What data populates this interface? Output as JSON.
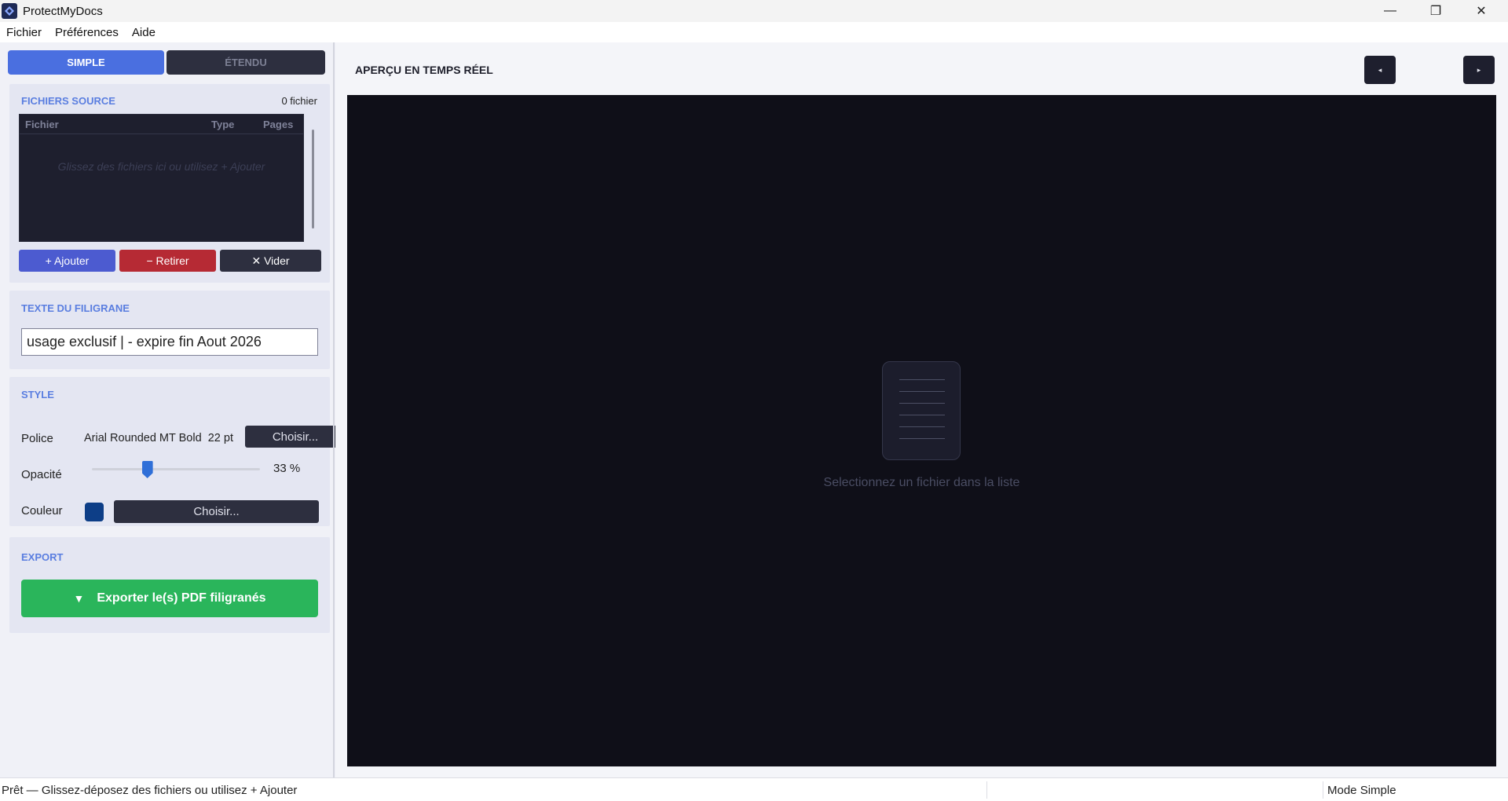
{
  "window": {
    "title": "ProtectMyDocs",
    "minimize": "—",
    "restore": "❐",
    "close": "✕"
  },
  "menu": {
    "items": [
      "Fichier",
      "Préférences",
      "Aide"
    ]
  },
  "mode": {
    "simple": "SIMPLE",
    "etendu": "ÉTENDU"
  },
  "sources": {
    "title": "FICHIERS SOURCE",
    "count": "0 fichier",
    "columns": [
      "Fichier",
      "Type",
      "Pages"
    ],
    "empty_hint": "Glissez des fichiers ici ou utilisez + Ajouter",
    "add_label": "+ Ajouter",
    "remove_label": "− Retirer",
    "clear_label": "✕ Vider"
  },
  "watermark": {
    "title": "TEXTE DU FILIGRANE",
    "value": "usage exclusif | - expire fin Aout 2026"
  },
  "style": {
    "title": "STYLE",
    "police_label": "Police",
    "font_name": "Arial Rounded MT Bold",
    "font_size": "22 pt",
    "choose_font_label": "Choisir...",
    "opacity_label": "Opacité",
    "opacity_value": "33 %",
    "opacity_fraction": 0.33,
    "color_label": "Couleur",
    "color_value": "#0d3e87",
    "choose_color_label": "Choisir..."
  },
  "export": {
    "title": "EXPORT",
    "button_label": "Exporter le(s) PDF filigranés",
    "icon": "▼"
  },
  "preview": {
    "title": "APERÇU EN TEMPS RÉEL",
    "prev": "◂",
    "next": "▸",
    "hint": "Selectionnez un fichier dans la liste"
  },
  "status": {
    "text": "Prêt  —  Glissez-déposez des fichiers ou utilisez + Ajouter",
    "mode": "Mode Simple"
  },
  "colors": {
    "accent": "#4a6fe0",
    "export_green": "#2ab55b",
    "remove_red": "#b62a34",
    "dark_panel": "#0f0f18"
  }
}
